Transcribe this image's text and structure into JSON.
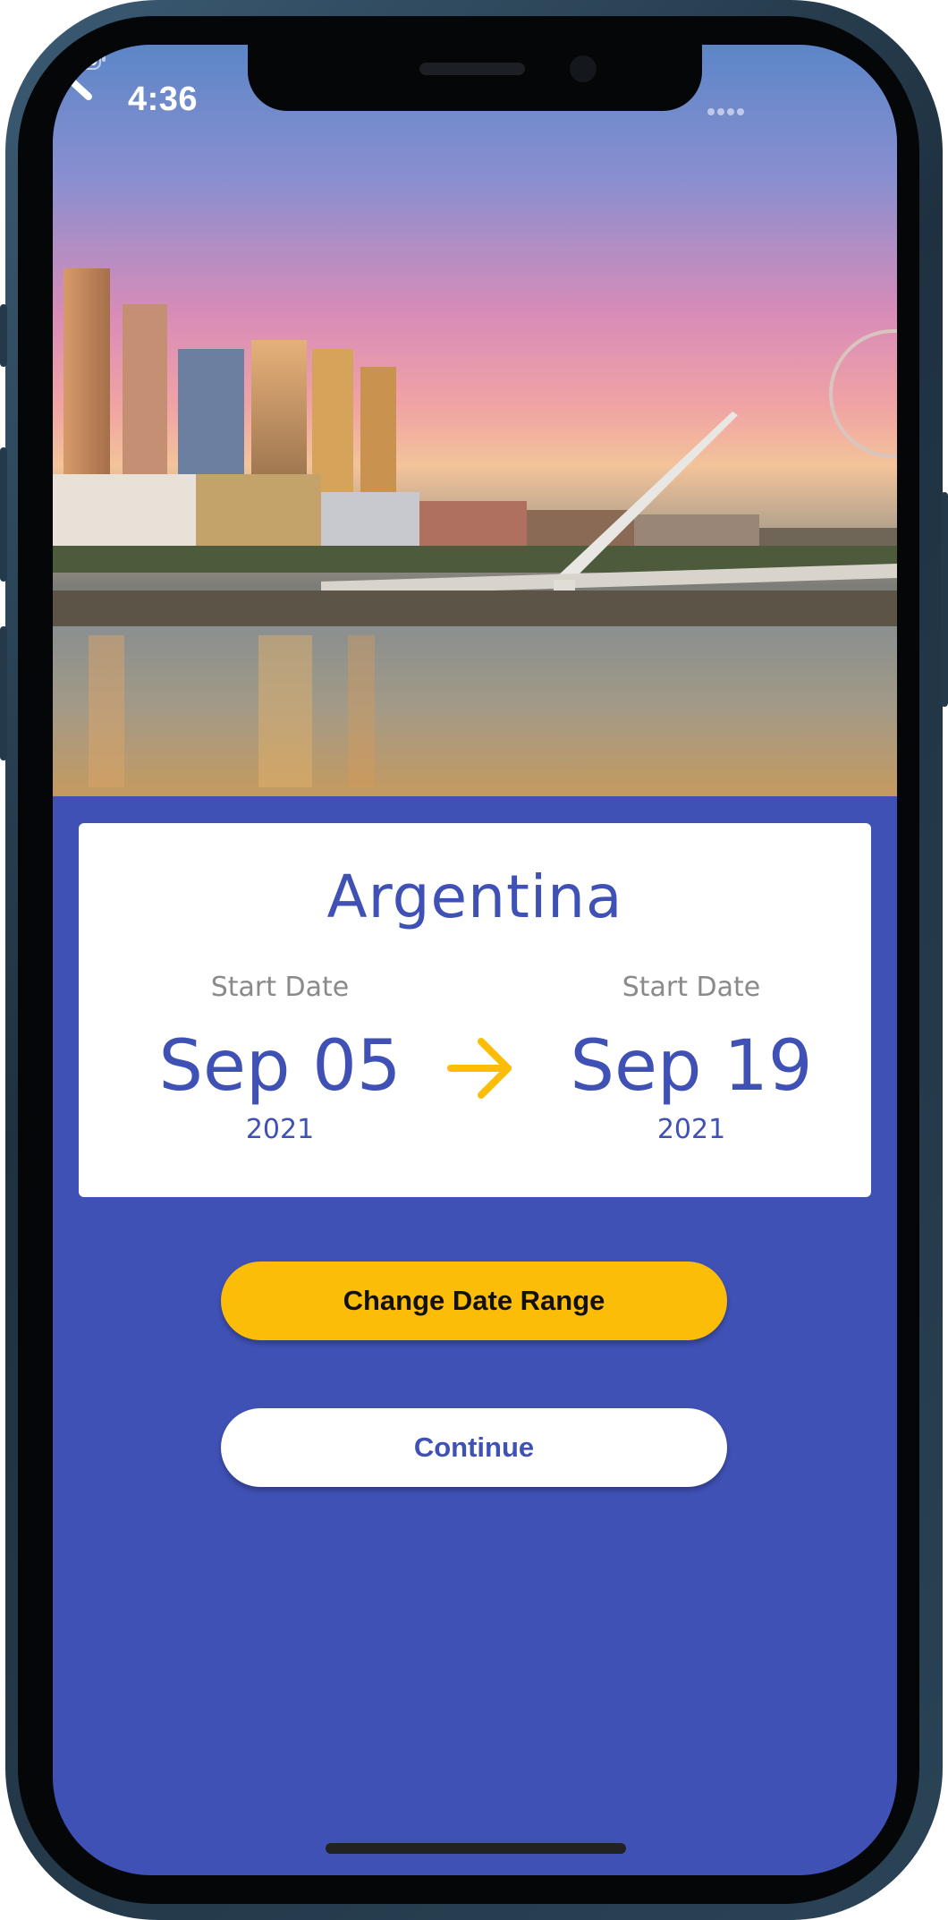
{
  "status_bar": {
    "time": "4:36",
    "icons": [
      "signal-dots-icon",
      "wifi-icon",
      "battery-icon"
    ]
  },
  "header": {
    "back_icon": "chevron-left-icon",
    "image_description": "city-skyline-photo"
  },
  "trip": {
    "country": "Argentina",
    "start": {
      "label": "Start Date",
      "date": "Sep 05",
      "year": "2021"
    },
    "end": {
      "label": "Start Date",
      "date": "Sep 19",
      "year": "2021"
    },
    "arrow_icon": "arrow-right-icon"
  },
  "actions": {
    "change_label": "Change Date Range",
    "continue_label": "Continue"
  },
  "colors": {
    "primary": "#3f51b5",
    "accent": "#fbbd08",
    "card": "#ffffff",
    "muted_text": "#8a8a8a"
  }
}
